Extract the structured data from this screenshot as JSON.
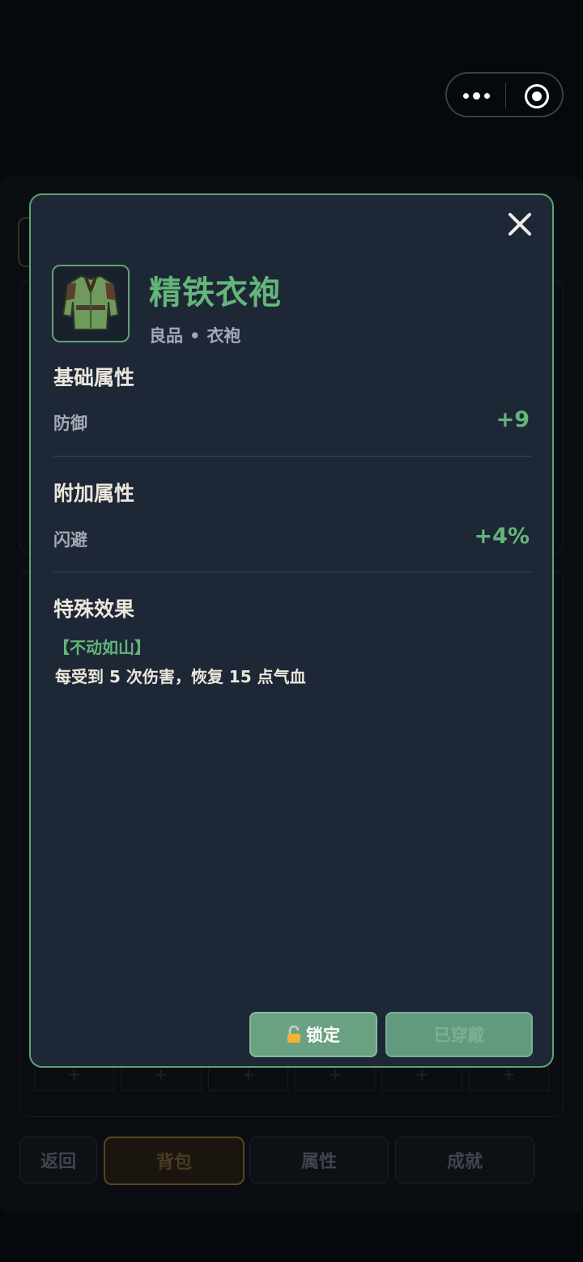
{
  "capsule": {
    "more_icon": "more-dots-icon",
    "close_icon": "target-circle-icon"
  },
  "item": {
    "name": "精铁衣袍",
    "quality": "良品",
    "separator": "•",
    "type": "衣袍",
    "image": "green-robe-image"
  },
  "base_stats": {
    "title": "基础属性",
    "rows": [
      {
        "label": "防御",
        "value": "+9"
      }
    ]
  },
  "extra_stats": {
    "title": "附加属性",
    "rows": [
      {
        "label": "闪避",
        "value": "+4%"
      }
    ]
  },
  "special": {
    "title": "特殊效果",
    "name": "【不动如山】",
    "description": "每受到 5 次伤害，恢复 15 点气血"
  },
  "actions": {
    "lock_label": "锁定",
    "lock_icon": "padlock-icon",
    "equipped_label": "已穿戴"
  },
  "bottom_nav": {
    "items": [
      "返回",
      "背包",
      "属性",
      "成就"
    ],
    "active": "背包"
  },
  "bg_slots": [
    "+",
    "+",
    "+",
    "+",
    "+",
    "+"
  ],
  "colors": {
    "accent": "#63b57a",
    "modal_bg": "#1e2736",
    "modal_border": "#5ea36f"
  }
}
